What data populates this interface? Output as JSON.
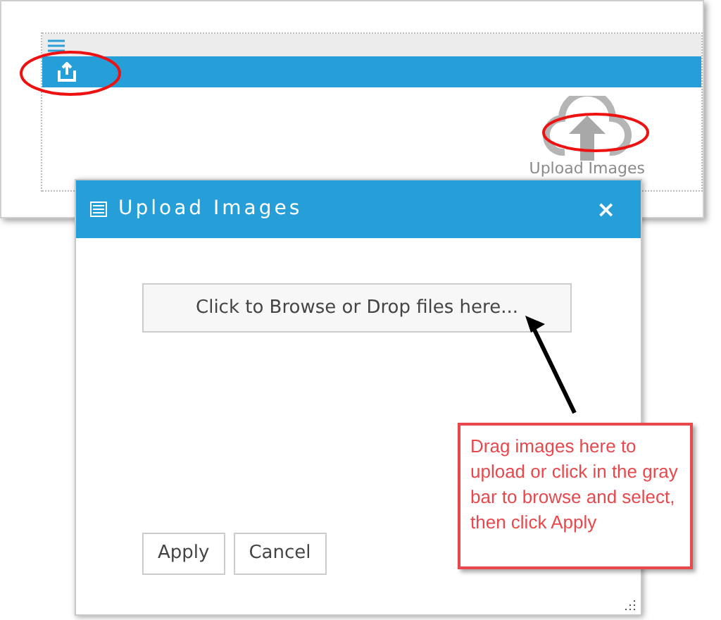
{
  "editor_panel": {
    "widget_label": "Upload Images"
  },
  "dialog": {
    "title": "Upload Images",
    "close": "×",
    "drop_zone": "Click to Browse or Drop files here...",
    "buttons": [
      "Apply",
      "Cancel"
    ]
  },
  "callout": {
    "text": "Drag images here to upload or click in the gray bar to browse and select, then click Apply"
  }
}
